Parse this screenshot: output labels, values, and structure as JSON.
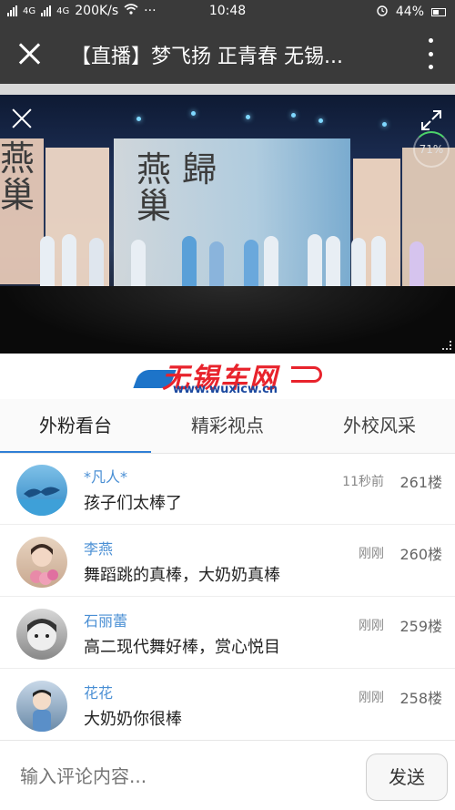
{
  "status_bar": {
    "network_left": "4G",
    "network_right": "4G",
    "speed": "200K/s",
    "dots": "···",
    "time": "10:48",
    "battery": "44%",
    "alarm_icon": "alarm-clock-icon",
    "wifi_icon": "wifi-icon"
  },
  "header": {
    "title": "【直播】梦飞扬 正青春 无锡..."
  },
  "video": {
    "calligraphy_left": "燕\n巢",
    "calligraphy_center": "燕 歸\n巢",
    "progress_percent": "71%"
  },
  "brand": {
    "name": "无锡车网",
    "url": "www.wuxicw.cn"
  },
  "tabs": [
    {
      "label": "外粉看台",
      "active": true
    },
    {
      "label": "精彩视点",
      "active": false
    },
    {
      "label": "外校风采",
      "active": false
    }
  ],
  "comments": [
    {
      "username": "*凡人*",
      "text": "孩子们太棒了",
      "time": "11秒前",
      "floor": "261楼",
      "avatar": "dolphin-avatar"
    },
    {
      "username": "李燕",
      "text": "舞蹈跳的真棒，大奶奶真棒",
      "time": "刚刚",
      "floor": "260楼",
      "avatar": "girl-flowers-avatar"
    },
    {
      "username": "石丽蕾",
      "text": "高二现代舞好棒，赏心悦目",
      "time": "刚刚",
      "floor": "259楼",
      "avatar": "bw-child-avatar"
    },
    {
      "username": "花花",
      "text": "大奶奶你很棒",
      "time": "刚刚",
      "floor": "258楼",
      "avatar": "child-avatar"
    }
  ],
  "input": {
    "placeholder": "输入评论内容...",
    "send_label": "发送"
  },
  "colors": {
    "header_bg": "#3a3a3a",
    "username": "#4a8fd4",
    "tab_underline": "#2f7fd6",
    "brand_red": "#e8232c",
    "brand_blue": "#1d4aa0"
  }
}
